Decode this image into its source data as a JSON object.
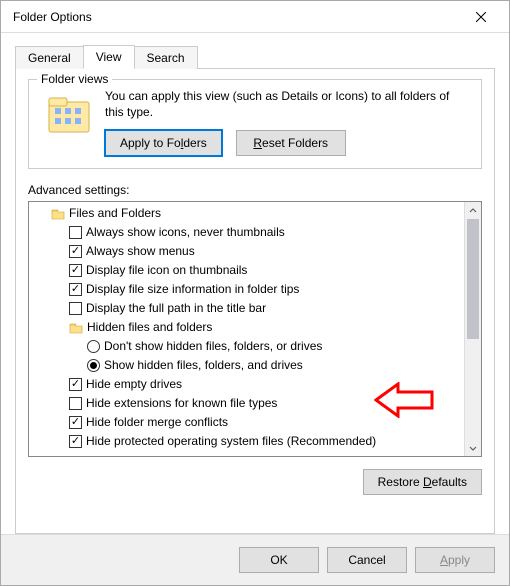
{
  "window": {
    "title": "Folder Options"
  },
  "tabs": {
    "general": "General",
    "view": "View",
    "search": "Search"
  },
  "folder_views": {
    "legend": "Folder views",
    "text": "You can apply this view (such as Details or Icons) to all folders of this type.",
    "apply_btn": "Apply to Folders",
    "reset_btn": "Reset Folders"
  },
  "advanced": {
    "label": "Advanced settings:",
    "root": "Files and Folders",
    "items": [
      {
        "type": "check",
        "checked": false,
        "label": "Always show icons, never thumbnails"
      },
      {
        "type": "check",
        "checked": true,
        "label": "Always show menus"
      },
      {
        "type": "check",
        "checked": true,
        "label": "Display file icon on thumbnails"
      },
      {
        "type": "check",
        "checked": true,
        "label": "Display file size information in folder tips"
      },
      {
        "type": "check",
        "checked": false,
        "label": "Display the full path in the title bar"
      },
      {
        "type": "folder",
        "label": "Hidden files and folders"
      },
      {
        "type": "radio",
        "selected": false,
        "label": "Don't show hidden files, folders, or drives"
      },
      {
        "type": "radio",
        "selected": true,
        "label": "Show hidden files, folders, and drives"
      },
      {
        "type": "check",
        "checked": true,
        "label": "Hide empty drives"
      },
      {
        "type": "check",
        "checked": false,
        "label": "Hide extensions for known file types"
      },
      {
        "type": "check",
        "checked": true,
        "label": "Hide folder merge conflicts"
      },
      {
        "type": "check",
        "checked": true,
        "label": "Hide protected operating system files (Recommended)"
      }
    ],
    "restore_btn": "Restore Defaults"
  },
  "buttons": {
    "ok": "OK",
    "cancel": "Cancel",
    "apply": "Apply"
  }
}
